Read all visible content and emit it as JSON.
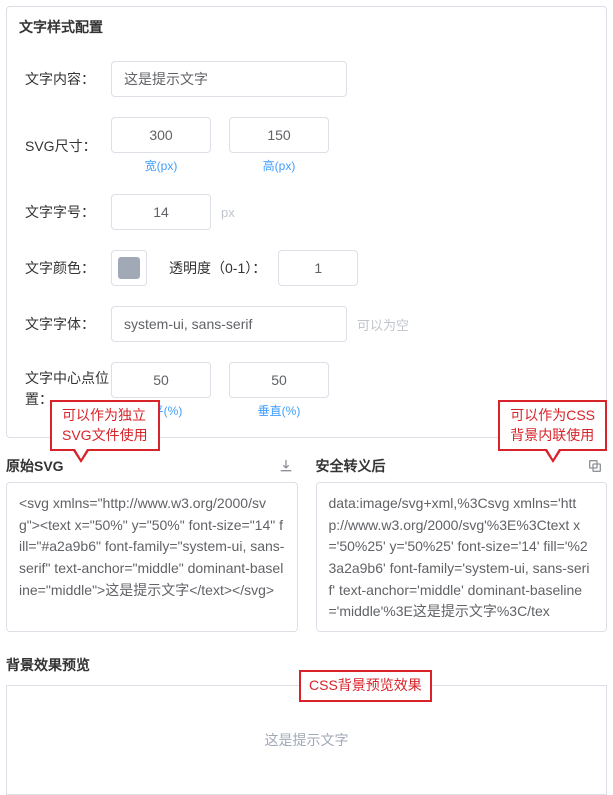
{
  "panel": {
    "title": "文字样式配置",
    "textContent": {
      "label": "文字内容：",
      "value": "这是提示文字"
    },
    "svgSize": {
      "label": "SVG尺寸：",
      "width": {
        "value": "300",
        "sub": "宽(px)"
      },
      "height": {
        "value": "150",
        "sub": "高(px)"
      }
    },
    "fontSize": {
      "label": "文字字号：",
      "value": "14",
      "unit": "px"
    },
    "color": {
      "label": "文字颜色：",
      "swatch": "#a2a9b6",
      "opacityLabel": "透明度（0-1）：",
      "opacityValue": "1"
    },
    "font": {
      "label": "文字字体：",
      "value": "system-ui, sans-serif",
      "hint": "可以为空"
    },
    "center": {
      "label": "文字中心点位置：",
      "h": {
        "value": "50",
        "sub": "水平(%)"
      },
      "v": {
        "value": "50",
        "sub": "垂直(%)"
      }
    }
  },
  "output": {
    "rawTitle": "原始SVG",
    "escTitle": "安全转义后",
    "rawCode": "<svg xmlns=\"http://www.w3.org/2000/svg\"><text x=\"50%\" y=\"50%\" font-size=\"14\" fill=\"#a2a9b6\" font-family=\"system-ui, sans-serif\" text-anchor=\"middle\" dominant-baseline=\"middle\">这是提示文字</text></svg>",
    "escCode": "data:image/svg+xml,%3Csvg xmlns='http://www.w3.org/2000/svg'%3E%3Ctext x='50%25' y='50%25' font-size='14' fill='%23a2a9b6' font-family='system-ui, sans-serif' text-anchor='middle' dominant-baseline='middle'%3E这是提示文字%3C/tex",
    "callout1": "可以作为独立\nSVG文件使用",
    "callout2": "可以作为CSS\n背景内联使用"
  },
  "preview": {
    "title": "背景效果预览",
    "text": "这是提示文字",
    "callout": "CSS背景预览效果"
  }
}
